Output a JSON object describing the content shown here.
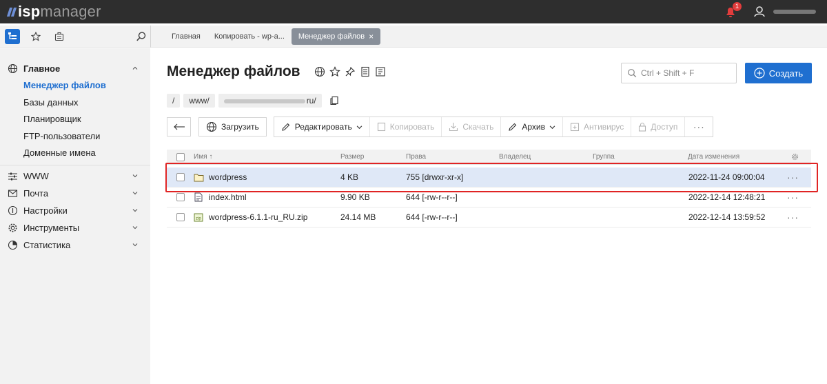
{
  "app": {
    "logo_isp": "isp",
    "logo_manager": "manager"
  },
  "topbar": {
    "notification_count": "1"
  },
  "navbar": {
    "tabs": [
      {
        "label": "Главная"
      },
      {
        "label": "Копировать - wp-a..."
      },
      {
        "label": "Менеджер файлов",
        "active": true
      }
    ]
  },
  "sidebar": {
    "main_section": "Главное",
    "items": [
      "Менеджер файлов",
      "Базы данных",
      "Планировщик",
      "FTP-пользователи",
      "Доменные имена"
    ],
    "sections": [
      "WWW",
      "Почта",
      "Настройки",
      "Инструменты",
      "Статистика"
    ]
  },
  "page": {
    "title": "Менеджер файлов",
    "search_placeholder": "Ctrl + Shift + F",
    "create_label": "Создать"
  },
  "path": {
    "root": "/",
    "seg1": "www/",
    "seg2_suffix": "ru/"
  },
  "toolbar": {
    "upload": "Загрузить",
    "edit": "Редактировать",
    "copy": "Копировать",
    "download": "Скачать",
    "archive": "Архив",
    "antivirus": "Антивирус",
    "access": "Доступ"
  },
  "table": {
    "headers": {
      "name": "Имя",
      "size": "Размер",
      "rights": "Права",
      "owner": "Владелец",
      "group": "Группа",
      "modified": "Дата изменения"
    },
    "rows": [
      {
        "name": "wordpress",
        "icon": "folder-icon",
        "size": "4 KB",
        "rights": "755 [drwxr-xr-x]",
        "modified": "2022-11-24 09:00:04",
        "selected": true
      },
      {
        "name": "index.html",
        "icon": "file-icon",
        "size": "9.90 KB",
        "rights": "644 [-rw-r--r--]",
        "modified": "2022-12-14 12:48:21"
      },
      {
        "name": "wordpress-6.1.1-ru_RU.zip",
        "icon": "zip-icon",
        "size": "24.14 MB",
        "rights": "644 [-rw-r--r--]",
        "modified": "2022-12-14 13:59:52"
      }
    ]
  },
  "colors": {
    "accent": "#1f6fd0",
    "highlight": "#e02424",
    "topbar": "#2e2e2e"
  }
}
